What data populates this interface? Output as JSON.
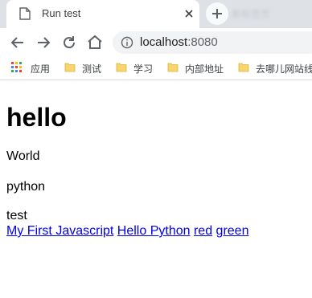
{
  "browser": {
    "tab_title": "Run test",
    "blurred_tab_text": "新标签页",
    "url_host": "localhost",
    "url_port": ":8080"
  },
  "bookmarks": [
    {
      "label": "应用",
      "icon": "apps-grid-icon"
    },
    {
      "label": "测试",
      "icon": "folder-icon"
    },
    {
      "label": "学习",
      "icon": "folder-icon"
    },
    {
      "label": "内部地址",
      "icon": "folder-icon"
    },
    {
      "label": "去哪儿网站线",
      "icon": "folder-icon"
    }
  ],
  "page": {
    "heading": "hello",
    "paragraphs": [
      "World",
      "python",
      "test"
    ],
    "links": [
      "My First Javascript",
      "Hello Python",
      "red",
      "green"
    ]
  },
  "colors": {
    "link": "#0000ee",
    "tabstrip": "#dee1e6",
    "folder": "#f8d66c"
  }
}
